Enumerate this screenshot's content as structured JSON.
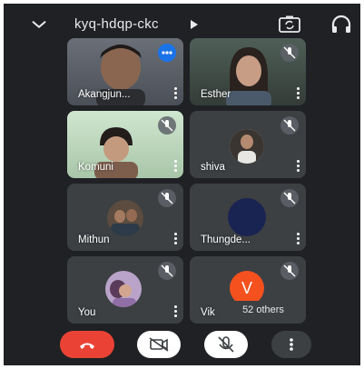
{
  "meeting": {
    "code": "kyq-hdqp-ckc"
  },
  "participants": [
    {
      "name": "Akangjun...",
      "state": "speaking"
    },
    {
      "name": "Esther",
      "state": "muted"
    },
    {
      "name": "Komuni",
      "state": "muted"
    },
    {
      "name": "shiva",
      "state": "muted"
    },
    {
      "name": "Mithun",
      "state": "muted"
    },
    {
      "name": "Thungde...",
      "state": "muted"
    },
    {
      "name": "You",
      "state": "muted"
    },
    {
      "name": "Vik",
      "state": "muted",
      "avatar_letter": "V"
    }
  ],
  "others_label": "52 others",
  "colors": {
    "background": "#202124",
    "tile": "#3c4043",
    "hangup": "#ea4335",
    "speaking": "#1a73e8",
    "avatar_v": "#f4511e"
  },
  "icons": {
    "top_left": "chevron-down-icon",
    "title_arrow": "play-arrow-icon",
    "camera_switch": "switch-camera-icon",
    "audio": "headphones-icon",
    "hangup": "phone-hangup-icon",
    "video": "video-off-icon",
    "mic": "mic-off-icon",
    "more": "more-vert-icon"
  }
}
